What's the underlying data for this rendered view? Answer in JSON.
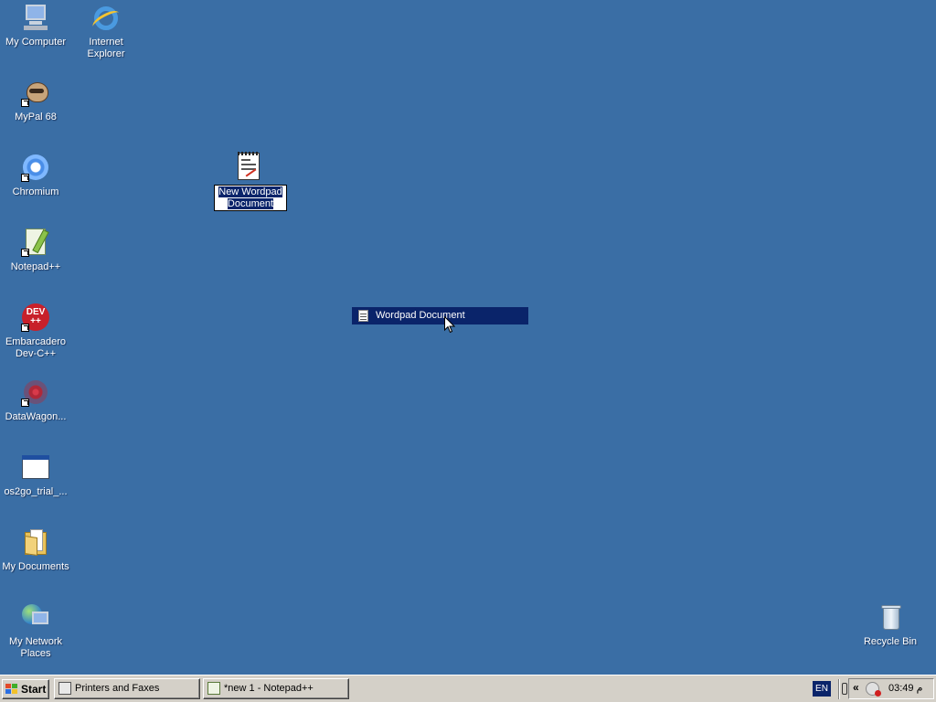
{
  "desktop": {
    "icons": [
      {
        "id": "my-computer",
        "label": "My Computer"
      },
      {
        "id": "internet-explorer",
        "label": "Internet Explorer"
      },
      {
        "id": "mypal",
        "label": "MyPal 68"
      },
      {
        "id": "chromium",
        "label": "Chromium"
      },
      {
        "id": "notepadpp",
        "label": "Notepad++"
      },
      {
        "id": "devcpp",
        "label": "Embarcadero Dev-C++",
        "badge": "DEV ++"
      },
      {
        "id": "datawagon",
        "label": "DataWagon..."
      },
      {
        "id": "os2go",
        "label": "os2go_trial_..."
      },
      {
        "id": "my-documents",
        "label": "My Documents"
      },
      {
        "id": "network",
        "label": "My Network Places"
      },
      {
        "id": "recycle-bin",
        "label": "Recycle Bin"
      }
    ],
    "renaming_file": {
      "icon": "wordpad-document-icon",
      "edit_value": "New Wordpad Document"
    },
    "drag_item": {
      "icon": "wordpad-document-icon",
      "label": "Wordpad Document"
    }
  },
  "taskbar": {
    "start_label": "Start",
    "buttons": [
      {
        "label": "Printers and Faxes",
        "icon": "printer-icon"
      },
      {
        "label": "*new 1 - Notepad++",
        "icon": "notepadpp-icon"
      }
    ],
    "language": "EN",
    "tray": {
      "chevron": "«",
      "clock": "03:49 م"
    }
  },
  "colors": {
    "desktop_bg": "#3a6ea5",
    "selection": "#0a246a",
    "taskbar": "#d4d0c8"
  }
}
